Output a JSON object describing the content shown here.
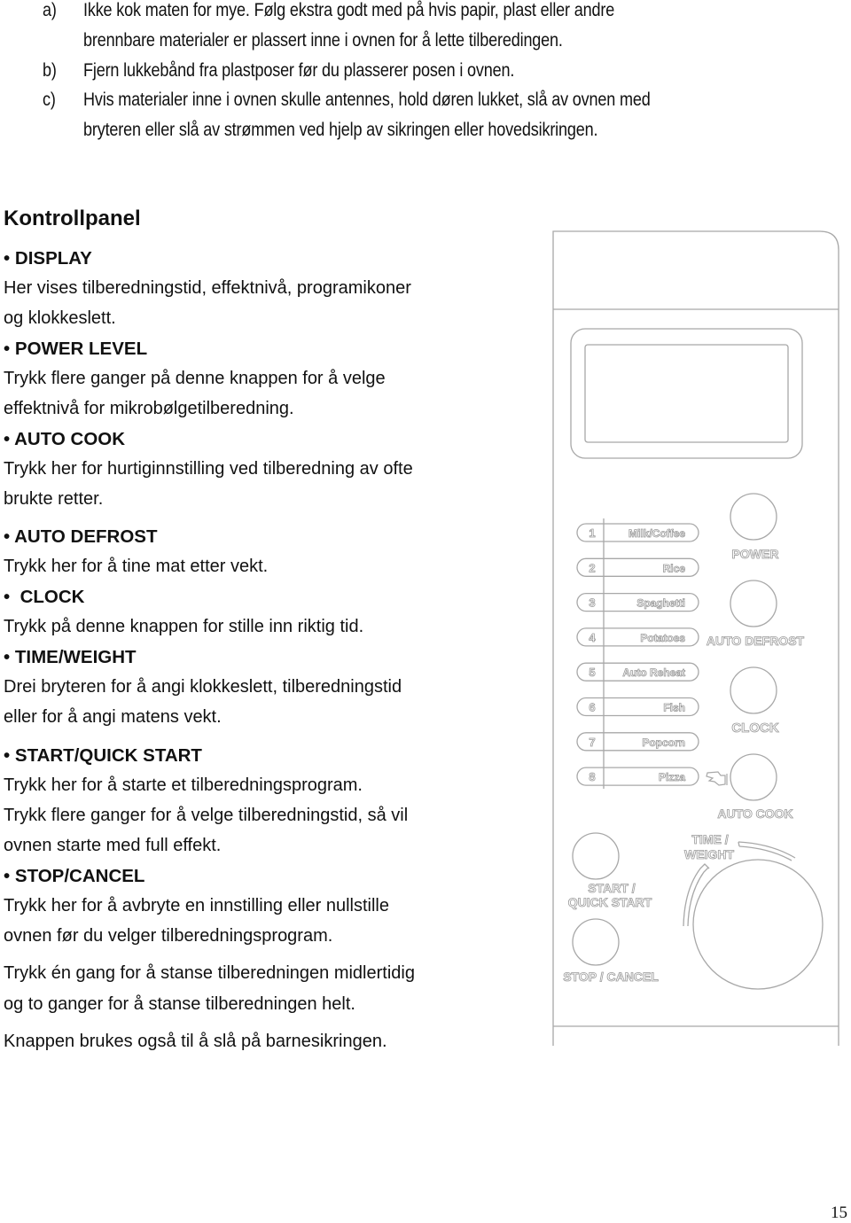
{
  "intro_list": [
    {
      "marker": "a)",
      "lines": [
        "Ikke kok maten for mye. Følg ekstra godt med på hvis papir, plast eller andre",
        "brennbare materialer er plassert inne i ovnen for å lette tilberedingen."
      ]
    },
    {
      "marker": "b)",
      "lines": [
        "Fjern lukkebånd fra plastposer før du plasserer posen i ovnen."
      ]
    },
    {
      "marker": "c)",
      "lines": [
        "Hvis materialer inne i ovnen skulle antennes, hold døren lukket, slå av ovnen med",
        "bryteren eller slå av strømmen ved hjelp av sikringen eller hovedsikringen."
      ]
    }
  ],
  "section_title": "Kontrollpanel",
  "bullet": "•",
  "controls": [
    {
      "name": "DISPLAY",
      "desc": [
        "Her vises tilberedningstid, effektnivå, programikoner",
        "og klokkeslett."
      ]
    },
    {
      "name": "POWER LEVEL",
      "desc": [
        "Trykk flere ganger på denne knappen for å velge",
        "effektnivå for mikrobølgetilberedning."
      ]
    },
    {
      "name": "AUTO COOK",
      "desc": [
        "Trykk her for hurtiginnstilling ved tilberedning av ofte",
        "brukte retter."
      ]
    },
    {
      "name": "AUTO DEFROST",
      "desc": [
        "Trykk her for å tine mat etter vekt."
      ]
    },
    {
      "name": "CLOCK",
      "desc": [
        "Trykk på denne knappen for stille inn riktig tid."
      ]
    },
    {
      "name": "TIME/WEIGHT",
      "desc": [
        "Drei bryteren for å angi klokkeslett, tilberedningstid",
        "eller for å angi matens vekt."
      ]
    },
    {
      "name": "START/QUICK START",
      "desc": [
        "Trykk her for å starte et tilberedningsprogram.",
        "Trykk flere ganger for å velge tilberedningstid, så vil",
        "ovnen starte med full effekt."
      ]
    },
    {
      "name": "STOP/CANCEL",
      "desc": [
        "Trykk her for å avbryte en innstilling eller nullstille",
        "ovnen før du velger tilberedningsprogram."
      ]
    }
  ],
  "extra_paragraphs": [
    [
      "Trykk én gang for å stanse tilberedningen midlertidig",
      "og to ganger for å stanse tilberedningen helt."
    ],
    [
      "Knappen brukes også til å slå på barnesikringen."
    ]
  ],
  "panel": {
    "programs": [
      {
        "num": "1",
        "label": "Milk/Coffee"
      },
      {
        "num": "2",
        "label": "Rice"
      },
      {
        "num": "3",
        "label": "Spaghetti"
      },
      {
        "num": "4",
        "label": "Potatoes"
      },
      {
        "num": "5",
        "label": "Auto Reheat"
      },
      {
        "num": "6",
        "label": "Fish"
      },
      {
        "num": "7",
        "label": "Popcorn"
      },
      {
        "num": "8",
        "label": "Pizza"
      }
    ],
    "buttons": {
      "power": "POWER",
      "auto_defrost": "AUTO DEFROST",
      "clock": "CLOCK",
      "auto_cook": "AUTO COOK",
      "start_line1": "START /",
      "start_line2": "QUICK START",
      "stop": "STOP / CANCEL",
      "time_line1": "TIME /",
      "time_line2": "WEIGHT"
    },
    "line_color": "#a8a8a8"
  },
  "page_number": "15"
}
